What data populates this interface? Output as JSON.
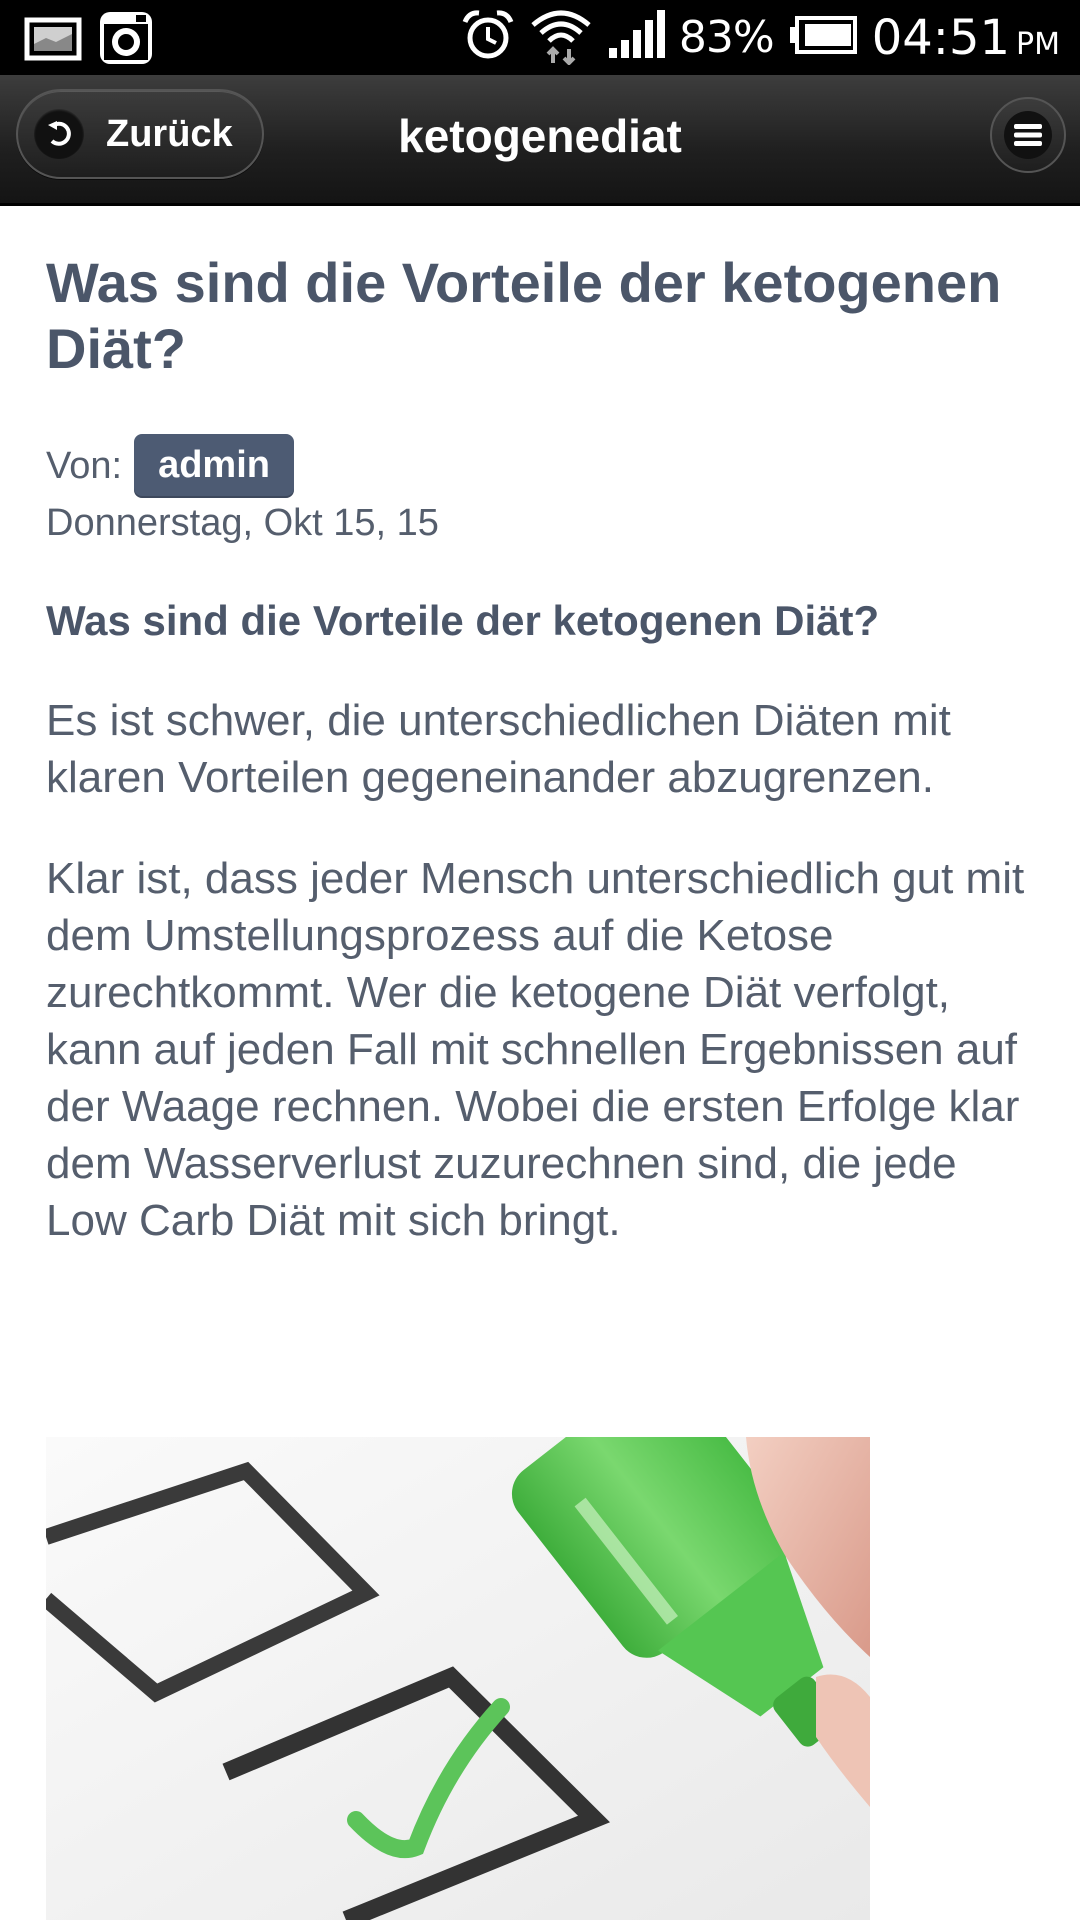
{
  "status_bar": {
    "battery_percent": "83%",
    "time": "04:51",
    "ampm": "PM",
    "icons": [
      "gallery-icon",
      "instagram-icon",
      "alarm-icon",
      "wifi-icon",
      "signal-icon",
      "battery-icon"
    ]
  },
  "app_bar": {
    "back_label": "Zurück",
    "title": "ketogenediat",
    "menu_icon": "menu-icon"
  },
  "article": {
    "title": "Was sind die Vorteile der ketogenen Diät?",
    "by_label": "Von:",
    "author": "admin",
    "date": "Donnerstag, Okt 15, 15",
    "subheading": "Was sind die Vorteile der ketogenen Diät?",
    "paragraphs": [
      "Es ist schwer, die unterschiedlichen Diäten mit klaren Vorteilen gegeneinander abzugrenzen.",
      "Klar ist, dass jeder Mensch unterschiedlich gut mit dem Umstellungsprozess auf die Ketose zurechtkommt. Wer die ketogene Diät verfolgt, kann auf jeden Fall mit schnellen Ergebnissen auf der Waage rechnen. Wobei die ersten Erfolge klar dem Wasserverlust zuzurechnen sind, die jede Low Carb Diät mit sich bringt."
    ],
    "image": "checkbox-marker-image"
  },
  "colors": {
    "status_bar_bg": "#000000",
    "app_bar_bg": "#1f1f1f",
    "text": "#555e6d",
    "badge_bg": "#4d5b73",
    "marker_green": "#5cc45a"
  }
}
